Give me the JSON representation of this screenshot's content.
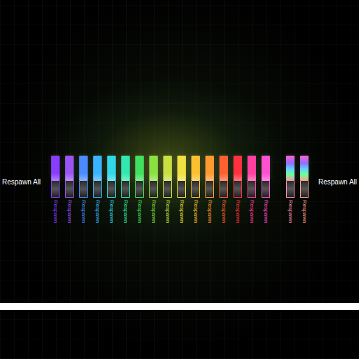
{
  "left_button": "Respawn All",
  "right_button": "Respawn All",
  "swatches": [
    {
      "label": "Respawn",
      "color": "#8a3cff",
      "kind": "solid"
    },
    {
      "label": "Respawn",
      "color": "#9b55f5",
      "kind": "solid"
    },
    {
      "label": "Respawn",
      "color": "#4a8cff",
      "kind": "solid"
    },
    {
      "label": "Respawn",
      "color": "#3ab4ff",
      "kind": "solid"
    },
    {
      "label": "Respawn",
      "color": "#30d8e8",
      "kind": "solid"
    },
    {
      "label": "Respawn",
      "color": "#30e8b0",
      "kind": "solid"
    },
    {
      "label": "Respawn",
      "color": "#40e060",
      "kind": "solid"
    },
    {
      "label": "Respawn",
      "color": "#8ae040",
      "kind": "solid"
    },
    {
      "label": "Respawn",
      "color": "#c8e040",
      "kind": "solid"
    },
    {
      "label": "Respawn",
      "color": "#f0e040",
      "kind": "solid"
    },
    {
      "label": "Respawn",
      "color": "#ffc030",
      "kind": "solid"
    },
    {
      "label": "Respawn",
      "color": "#ff9a30",
      "kind": "solid"
    },
    {
      "label": "Respawn",
      "color": "#ff6030",
      "kind": "solid"
    },
    {
      "label": "Respawn",
      "color": "#ff3040",
      "kind": "solid"
    },
    {
      "label": "Respawn",
      "color": "#ff40a0",
      "kind": "solid"
    },
    {
      "label": "Respawn",
      "color": "#ff50d0",
      "kind": "solid"
    },
    {
      "label": "Respawn",
      "color": "#ff90b0",
      "kind": "rainbow"
    },
    {
      "label": "Respawn",
      "color": "#ffa090",
      "kind": "rainbow"
    }
  ]
}
